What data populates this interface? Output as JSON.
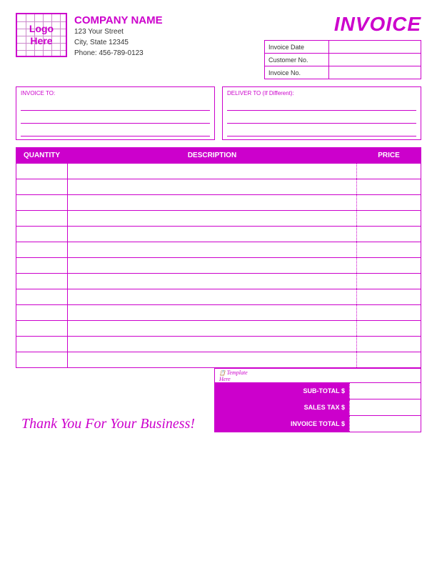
{
  "header": {
    "logo_line1": "Logo",
    "logo_line2": "Here",
    "company_name": "COMPANY NAME",
    "address_line1": "123 Your Street",
    "address_line2": "City, State 12345",
    "address_line3": "Phone: 456-789-0123",
    "invoice_title": "INVOICE",
    "fields": [
      {
        "label": "Invoice Date",
        "value": ""
      },
      {
        "label": "Customer No.",
        "value": ""
      },
      {
        "label": "Invoice No.",
        "value": ""
      }
    ]
  },
  "address": {
    "invoice_to_label": "INVOICE TO:",
    "deliver_to_label": "DELIVER TO (If Different):"
  },
  "table": {
    "col_quantity": "QUANTITY",
    "col_description": "DESCRIPTION",
    "col_price": "PRICE",
    "rows": 13
  },
  "totals": {
    "subtotal_label": "SUB-TOTAL $",
    "salestax_label": "SALES TAX $",
    "invoicetotal_label": "INVOICE TOTAL $",
    "subtotal_value": "",
    "salestax_value": "",
    "invoicetotal_value": ""
  },
  "footer": {
    "thank_you": "Thank You For Your Business!"
  }
}
